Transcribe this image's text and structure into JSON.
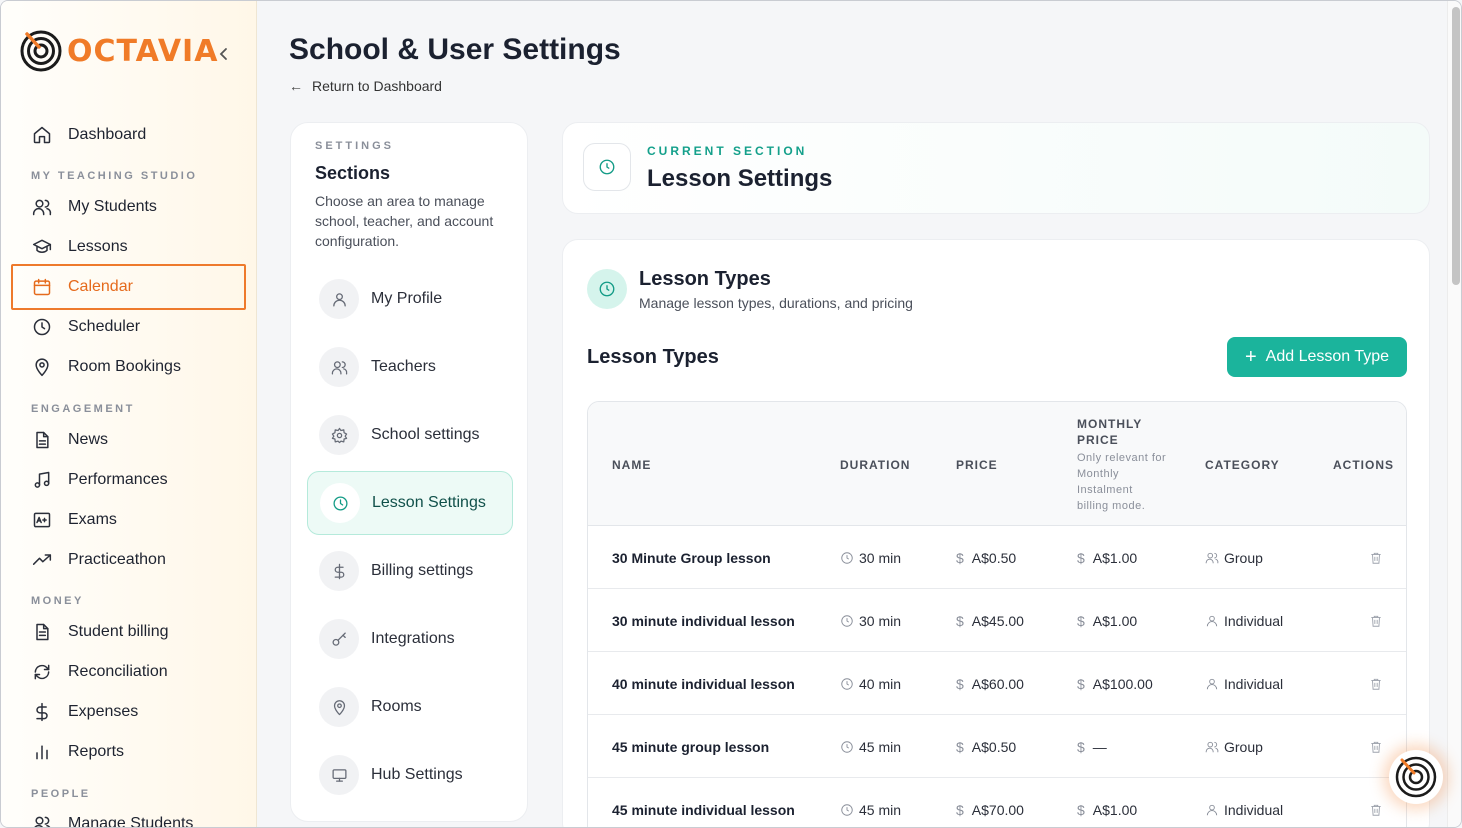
{
  "app": {
    "name": "OCTAVIA",
    "brand_color": "#f07b28",
    "accent_color": "#1bb49c"
  },
  "sidebar": {
    "items": [
      {
        "label": "Dashboard",
        "icon": "home-icon"
      },
      {
        "group": "MY TEACHING STUDIO"
      },
      {
        "label": "My Students",
        "icon": "users-icon"
      },
      {
        "label": "Lessons",
        "icon": "graduation-cap-icon"
      },
      {
        "label": "Calendar",
        "icon": "calendar-icon",
        "active": true
      },
      {
        "label": "Scheduler",
        "icon": "clock-icon"
      },
      {
        "label": "Room Bookings",
        "icon": "map-pin-icon"
      },
      {
        "group": "ENGAGEMENT"
      },
      {
        "label": "News",
        "icon": "document-icon"
      },
      {
        "label": "Performances",
        "icon": "music-note-icon"
      },
      {
        "label": "Exams",
        "icon": "grade-icon"
      },
      {
        "label": "Practiceathon",
        "icon": "trend-up-icon"
      },
      {
        "group": "MONEY"
      },
      {
        "label": "Student billing",
        "icon": "invoice-icon"
      },
      {
        "label": "Reconciliation",
        "icon": "refresh-icon"
      },
      {
        "label": "Expenses",
        "icon": "dollar-icon"
      },
      {
        "label": "Reports",
        "icon": "bar-chart-icon"
      },
      {
        "group": "PEOPLE"
      },
      {
        "label": "Manage Students",
        "icon": "users-icon"
      }
    ]
  },
  "header": {
    "title": "School & User Settings",
    "back_label": "Return to Dashboard"
  },
  "settings_panel": {
    "eyebrow": "SETTINGS",
    "title": "Sections",
    "description": "Choose an area to manage school, teacher, and account configuration.",
    "sections": [
      {
        "label": "My Profile",
        "icon": "user-icon"
      },
      {
        "label": "Teachers",
        "icon": "users-icon"
      },
      {
        "label": "School settings",
        "icon": "gear-icon"
      },
      {
        "label": "Lesson Settings",
        "icon": "clock-icon",
        "active": true
      },
      {
        "label": "Billing settings",
        "icon": "dollar-icon"
      },
      {
        "label": "Integrations",
        "icon": "key-icon"
      },
      {
        "label": "Rooms",
        "icon": "map-pin-icon"
      },
      {
        "label": "Hub Settings",
        "icon": "monitor-icon"
      }
    ]
  },
  "current_section": {
    "eyebrow": "CURRENT SECTION",
    "title": "Lesson Settings"
  },
  "lesson_types_card": {
    "title": "Lesson Types",
    "subtitle": "Manage lesson types, durations, and pricing",
    "section_title": "Lesson Types",
    "add_button_label": "Add Lesson Type",
    "columns": {
      "name": "NAME",
      "duration": "DURATION",
      "price": "PRICE",
      "monthly_price": "MONTHLY PRICE",
      "monthly_price_note": "Only relevant for Monthly Instalment billing mode.",
      "category": "CATEGORY",
      "actions": "ACTIONS"
    },
    "rows": [
      {
        "name": "30 Minute Group lesson",
        "duration": "30 min",
        "price": "A$0.50",
        "monthly_price": "A$1.00",
        "category": "Group"
      },
      {
        "name": "30 minute individual lesson",
        "duration": "30 min",
        "price": "A$45.00",
        "monthly_price": "A$1.00",
        "category": "Individual"
      },
      {
        "name": "40 minute individual lesson",
        "duration": "40 min",
        "price": "A$60.00",
        "monthly_price": "A$100.00",
        "category": "Individual"
      },
      {
        "name": "45 minute group lesson",
        "duration": "45 min",
        "price": "A$0.50",
        "monthly_price": "—",
        "category": "Group"
      },
      {
        "name": "45 minute individual lesson",
        "duration": "45 min",
        "price": "A$70.00",
        "monthly_price": "A$1.00",
        "category": "Individual"
      }
    ]
  }
}
